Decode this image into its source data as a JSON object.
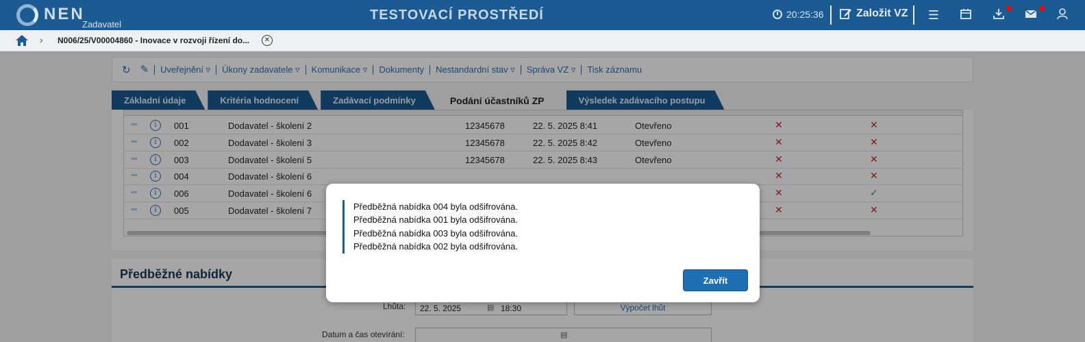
{
  "header": {
    "logo_text": "NEN",
    "logo_sub": "Zadavatel",
    "env_title": "TESTOVACÍ PROSTŘEDÍ",
    "time": "20:25:36",
    "create_label": "Založit VZ"
  },
  "breadcrumb": {
    "current": "N006/25/V00004860 - Inovace v rozvoji řízení do..."
  },
  "toolbar": {
    "items": [
      "Uveřejnění ▿",
      "Úkony zadavatele ▿",
      "Komunikace ▿",
      "Dokumenty",
      "Nestandardní stav ▿",
      "Správa VZ ▿",
      "Tisk záznamu"
    ]
  },
  "tabs": [
    "Základní údaje",
    "Kritéria hodnocení",
    "Zadávací podmínky",
    "Podání účastníků ZP",
    "Výsledek zadávacího postupu"
  ],
  "grid": {
    "rows": [
      {
        "cislo": "001",
        "nazev": "Dodavatel - školení 2",
        "ico": "12345678",
        "datum": "22. 5. 2025 8:41",
        "stav": "Otevřeno",
        "podepsana": "x",
        "listinna": "x"
      },
      {
        "cislo": "002",
        "nazev": "Dodavatel - školení 3",
        "ico": "12345678",
        "datum": "22. 5. 2025 8:42",
        "stav": "Otevřeno",
        "podepsana": "x",
        "listinna": "x"
      },
      {
        "cislo": "003",
        "nazev": "Dodavatel - školení 5",
        "ico": "12345678",
        "datum": "22. 5. 2025 8:43",
        "stav": "Otevřeno",
        "podepsana": "x",
        "listinna": "x"
      },
      {
        "cislo": "004",
        "nazev": "Dodavatel - školení 6",
        "ico": "",
        "datum": "",
        "stav": "",
        "podepsana": "x",
        "listinna": "x"
      },
      {
        "cislo": "006",
        "nazev": "Dodavatel - školení 6",
        "ico": "",
        "datum": "",
        "stav": "",
        "podepsana": "x",
        "listinna": "check"
      },
      {
        "cislo": "005",
        "nazev": "Dodavatel - školení 7",
        "ico": "",
        "datum": "",
        "stav": "",
        "podepsana": "x",
        "listinna": "x"
      }
    ]
  },
  "section2": {
    "title": "Předběžné nabídky",
    "lhuta_label": "Lhůta:",
    "lhuta_date": "22. 5. 2025",
    "lhuta_time": "18:30",
    "vypocet_label": "Výpočet lhůt",
    "datum_label": "Datum a čas otevírání:"
  },
  "modal": {
    "messages": [
      "Předběžná nabídka 004 byla odšifrována.",
      "Předběžná nabídka 001 byla odšifrována.",
      "Předběžná nabídka 003 byla odšifrována.",
      "Předběžná nabídka 002 byla odšifrována."
    ],
    "close_label": "Zavřít"
  },
  "colors": {
    "brand": "#1b5a92",
    "button": "#1f6fb5",
    "error": "#c0282d",
    "ok": "#2a9a3a"
  }
}
